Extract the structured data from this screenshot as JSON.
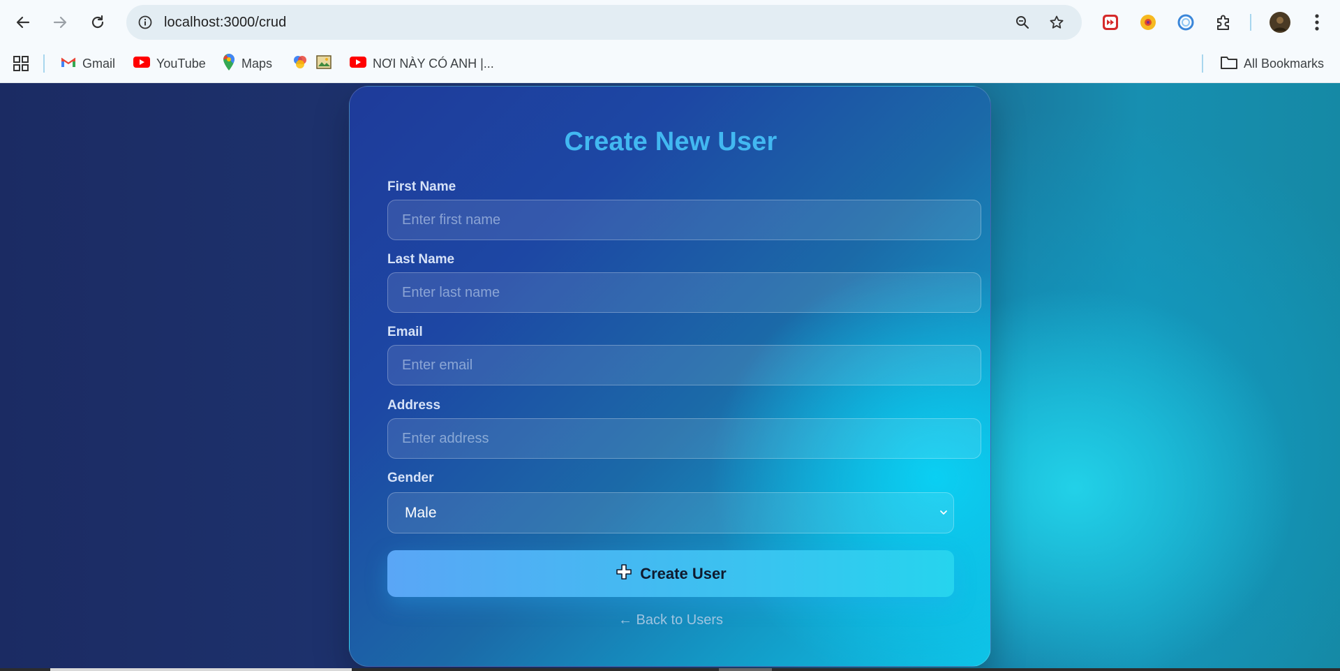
{
  "browser": {
    "url": "localhost:3000/crud",
    "bookmarks": [
      {
        "label": "Gmail",
        "icon": "gmail-icon"
      },
      {
        "label": "YouTube",
        "icon": "youtube-icon"
      },
      {
        "label": "Maps",
        "icon": "maps-icon"
      },
      {
        "label": "NƠI NÀY CÓ ANH |...",
        "icon": "youtube-icon"
      }
    ],
    "all_bookmarks": "All Bookmarks"
  },
  "form": {
    "title": "Create New User",
    "fields": [
      {
        "label": "First Name",
        "placeholder": "Enter first name",
        "value": ""
      },
      {
        "label": "Last Name",
        "placeholder": "Enter last name",
        "value": ""
      },
      {
        "label": "Email",
        "placeholder": "Enter email",
        "value": ""
      },
      {
        "label": "Address",
        "placeholder": "Enter address",
        "value": ""
      }
    ],
    "gender": {
      "label": "Gender",
      "selected": "Male"
    },
    "submit_label": "Create User",
    "back_link": "← Back to Users"
  },
  "colors": {
    "title": "#42b8f1",
    "button_start": "#5aa6f6",
    "button_end": "#26d4ee"
  }
}
